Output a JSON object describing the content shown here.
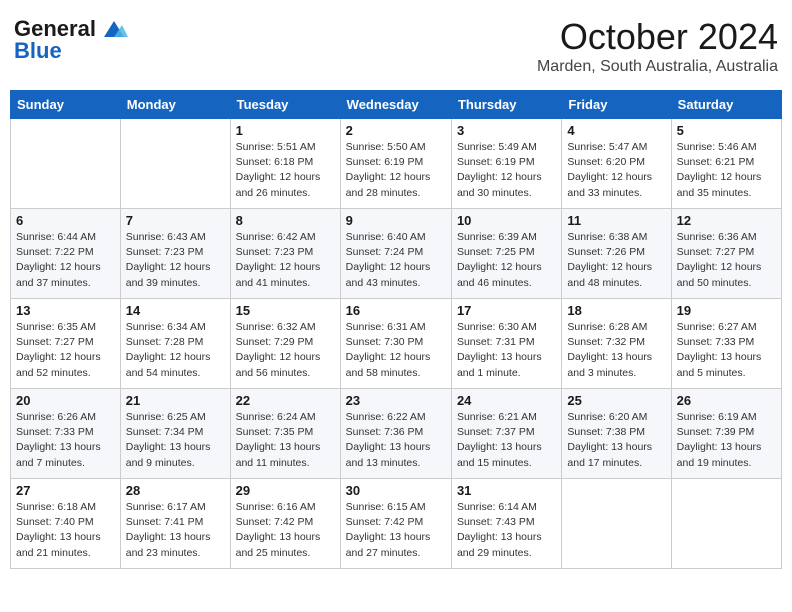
{
  "header": {
    "logo_general": "General",
    "logo_blue": "Blue",
    "month": "October 2024",
    "location": "Marden, South Australia, Australia"
  },
  "days_of_week": [
    "Sunday",
    "Monday",
    "Tuesday",
    "Wednesday",
    "Thursday",
    "Friday",
    "Saturday"
  ],
  "weeks": [
    [
      {
        "day": "",
        "info": ""
      },
      {
        "day": "",
        "info": ""
      },
      {
        "day": "1",
        "info": "Sunrise: 5:51 AM\nSunset: 6:18 PM\nDaylight: 12 hours\nand 26 minutes."
      },
      {
        "day": "2",
        "info": "Sunrise: 5:50 AM\nSunset: 6:19 PM\nDaylight: 12 hours\nand 28 minutes."
      },
      {
        "day": "3",
        "info": "Sunrise: 5:49 AM\nSunset: 6:19 PM\nDaylight: 12 hours\nand 30 minutes."
      },
      {
        "day": "4",
        "info": "Sunrise: 5:47 AM\nSunset: 6:20 PM\nDaylight: 12 hours\nand 33 minutes."
      },
      {
        "day": "5",
        "info": "Sunrise: 5:46 AM\nSunset: 6:21 PM\nDaylight: 12 hours\nand 35 minutes."
      }
    ],
    [
      {
        "day": "6",
        "info": "Sunrise: 6:44 AM\nSunset: 7:22 PM\nDaylight: 12 hours\nand 37 minutes."
      },
      {
        "day": "7",
        "info": "Sunrise: 6:43 AM\nSunset: 7:23 PM\nDaylight: 12 hours\nand 39 minutes."
      },
      {
        "day": "8",
        "info": "Sunrise: 6:42 AM\nSunset: 7:23 PM\nDaylight: 12 hours\nand 41 minutes."
      },
      {
        "day": "9",
        "info": "Sunrise: 6:40 AM\nSunset: 7:24 PM\nDaylight: 12 hours\nand 43 minutes."
      },
      {
        "day": "10",
        "info": "Sunrise: 6:39 AM\nSunset: 7:25 PM\nDaylight: 12 hours\nand 46 minutes."
      },
      {
        "day": "11",
        "info": "Sunrise: 6:38 AM\nSunset: 7:26 PM\nDaylight: 12 hours\nand 48 minutes."
      },
      {
        "day": "12",
        "info": "Sunrise: 6:36 AM\nSunset: 7:27 PM\nDaylight: 12 hours\nand 50 minutes."
      }
    ],
    [
      {
        "day": "13",
        "info": "Sunrise: 6:35 AM\nSunset: 7:27 PM\nDaylight: 12 hours\nand 52 minutes."
      },
      {
        "day": "14",
        "info": "Sunrise: 6:34 AM\nSunset: 7:28 PM\nDaylight: 12 hours\nand 54 minutes."
      },
      {
        "day": "15",
        "info": "Sunrise: 6:32 AM\nSunset: 7:29 PM\nDaylight: 12 hours\nand 56 minutes."
      },
      {
        "day": "16",
        "info": "Sunrise: 6:31 AM\nSunset: 7:30 PM\nDaylight: 12 hours\nand 58 minutes."
      },
      {
        "day": "17",
        "info": "Sunrise: 6:30 AM\nSunset: 7:31 PM\nDaylight: 13 hours\nand 1 minute."
      },
      {
        "day": "18",
        "info": "Sunrise: 6:28 AM\nSunset: 7:32 PM\nDaylight: 13 hours\nand 3 minutes."
      },
      {
        "day": "19",
        "info": "Sunrise: 6:27 AM\nSunset: 7:33 PM\nDaylight: 13 hours\nand 5 minutes."
      }
    ],
    [
      {
        "day": "20",
        "info": "Sunrise: 6:26 AM\nSunset: 7:33 PM\nDaylight: 13 hours\nand 7 minutes."
      },
      {
        "day": "21",
        "info": "Sunrise: 6:25 AM\nSunset: 7:34 PM\nDaylight: 13 hours\nand 9 minutes."
      },
      {
        "day": "22",
        "info": "Sunrise: 6:24 AM\nSunset: 7:35 PM\nDaylight: 13 hours\nand 11 minutes."
      },
      {
        "day": "23",
        "info": "Sunrise: 6:22 AM\nSunset: 7:36 PM\nDaylight: 13 hours\nand 13 minutes."
      },
      {
        "day": "24",
        "info": "Sunrise: 6:21 AM\nSunset: 7:37 PM\nDaylight: 13 hours\nand 15 minutes."
      },
      {
        "day": "25",
        "info": "Sunrise: 6:20 AM\nSunset: 7:38 PM\nDaylight: 13 hours\nand 17 minutes."
      },
      {
        "day": "26",
        "info": "Sunrise: 6:19 AM\nSunset: 7:39 PM\nDaylight: 13 hours\nand 19 minutes."
      }
    ],
    [
      {
        "day": "27",
        "info": "Sunrise: 6:18 AM\nSunset: 7:40 PM\nDaylight: 13 hours\nand 21 minutes."
      },
      {
        "day": "28",
        "info": "Sunrise: 6:17 AM\nSunset: 7:41 PM\nDaylight: 13 hours\nand 23 minutes."
      },
      {
        "day": "29",
        "info": "Sunrise: 6:16 AM\nSunset: 7:42 PM\nDaylight: 13 hours\nand 25 minutes."
      },
      {
        "day": "30",
        "info": "Sunrise: 6:15 AM\nSunset: 7:42 PM\nDaylight: 13 hours\nand 27 minutes."
      },
      {
        "day": "31",
        "info": "Sunrise: 6:14 AM\nSunset: 7:43 PM\nDaylight: 13 hours\nand 29 minutes."
      },
      {
        "day": "",
        "info": ""
      },
      {
        "day": "",
        "info": ""
      }
    ]
  ]
}
